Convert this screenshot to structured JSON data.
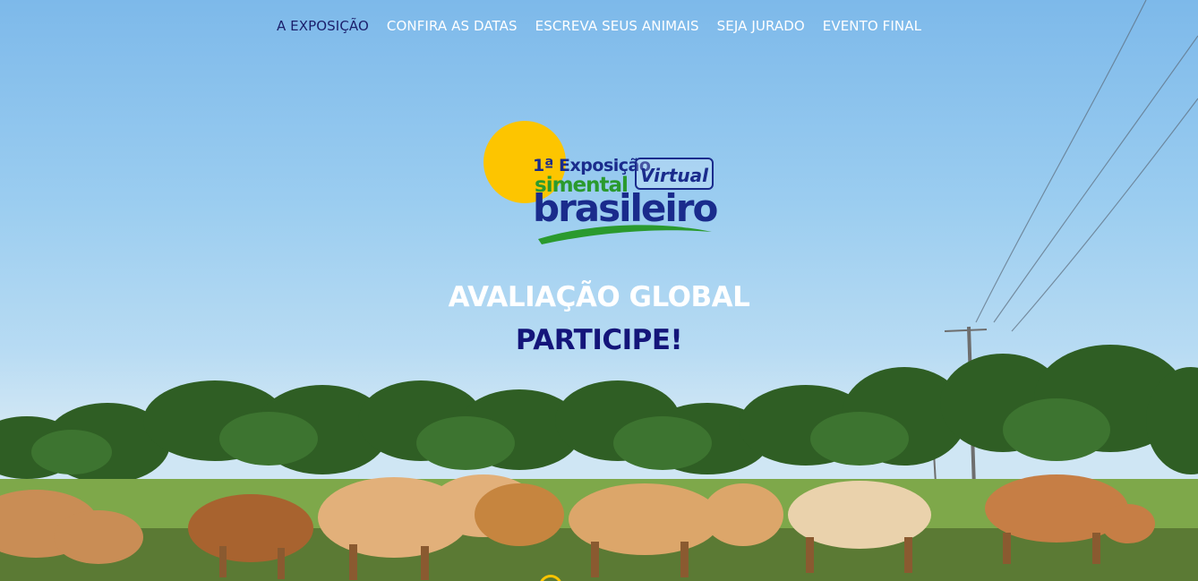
{
  "nav": {
    "items": [
      {
        "label": "A EXPOSIÇÃO",
        "active": true
      },
      {
        "label": "CONFIRA AS DATAS",
        "active": false
      },
      {
        "label": "ESCREVA SEUS ANIMAIS",
        "active": false
      },
      {
        "label": "SEJA JURADO",
        "active": false
      },
      {
        "label": "EVENTO FINAL",
        "active": false
      }
    ]
  },
  "logo": {
    "line1": "1ª Exposição",
    "badge": "Virtual",
    "line2": "simental",
    "line3": "brasileiro"
  },
  "hero": {
    "title": "AVALIAÇÃO GLOBAL",
    "cta": "PARTICIPE!"
  },
  "colors": {
    "nav_active": "#1b1f6b",
    "sun": "#fdc500",
    "brand_blue": "#1a2b8c",
    "brand_green": "#2a9a2e",
    "cta": "#14157a"
  },
  "icons": {
    "scroll": "circle-icon"
  }
}
